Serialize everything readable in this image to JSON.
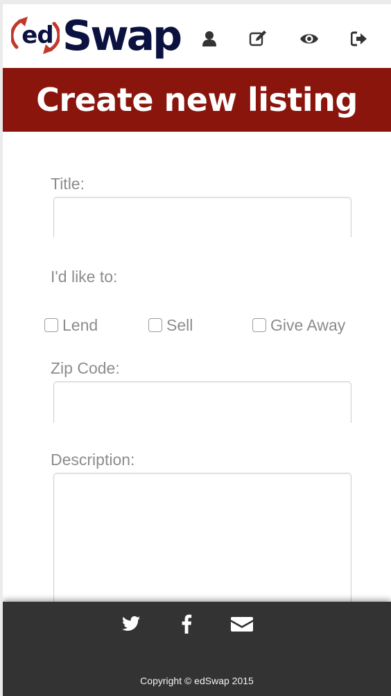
{
  "brand": {
    "ed": "ed",
    "swap": "Swap"
  },
  "nav": [
    {
      "name": "user-icon"
    },
    {
      "name": "edit-icon"
    },
    {
      "name": "eye-icon"
    },
    {
      "name": "sign-out-icon"
    }
  ],
  "banner": {
    "title": "Create new listing"
  },
  "form": {
    "title_label": "Title:",
    "title_value": "",
    "intent_label": "I'd like to:",
    "options": [
      {
        "label": "Lend",
        "checked": false
      },
      {
        "label": "Sell",
        "checked": false
      },
      {
        "label": "Give Away",
        "checked": false
      }
    ],
    "zip_label": "Zip Code:",
    "zip_value": "",
    "description_label": "Description:",
    "description_value": ""
  },
  "footer": {
    "social": [
      "twitter-icon",
      "facebook-icon",
      "envelope-icon"
    ],
    "copyright": "Copyright © edSwap 2015"
  },
  "colors": {
    "brand_navy": "#0b1240",
    "brand_red": "#c0392b",
    "banner_bg": "#8a150d",
    "footer_bg": "#333333",
    "label_gray": "#8c8c8c"
  }
}
